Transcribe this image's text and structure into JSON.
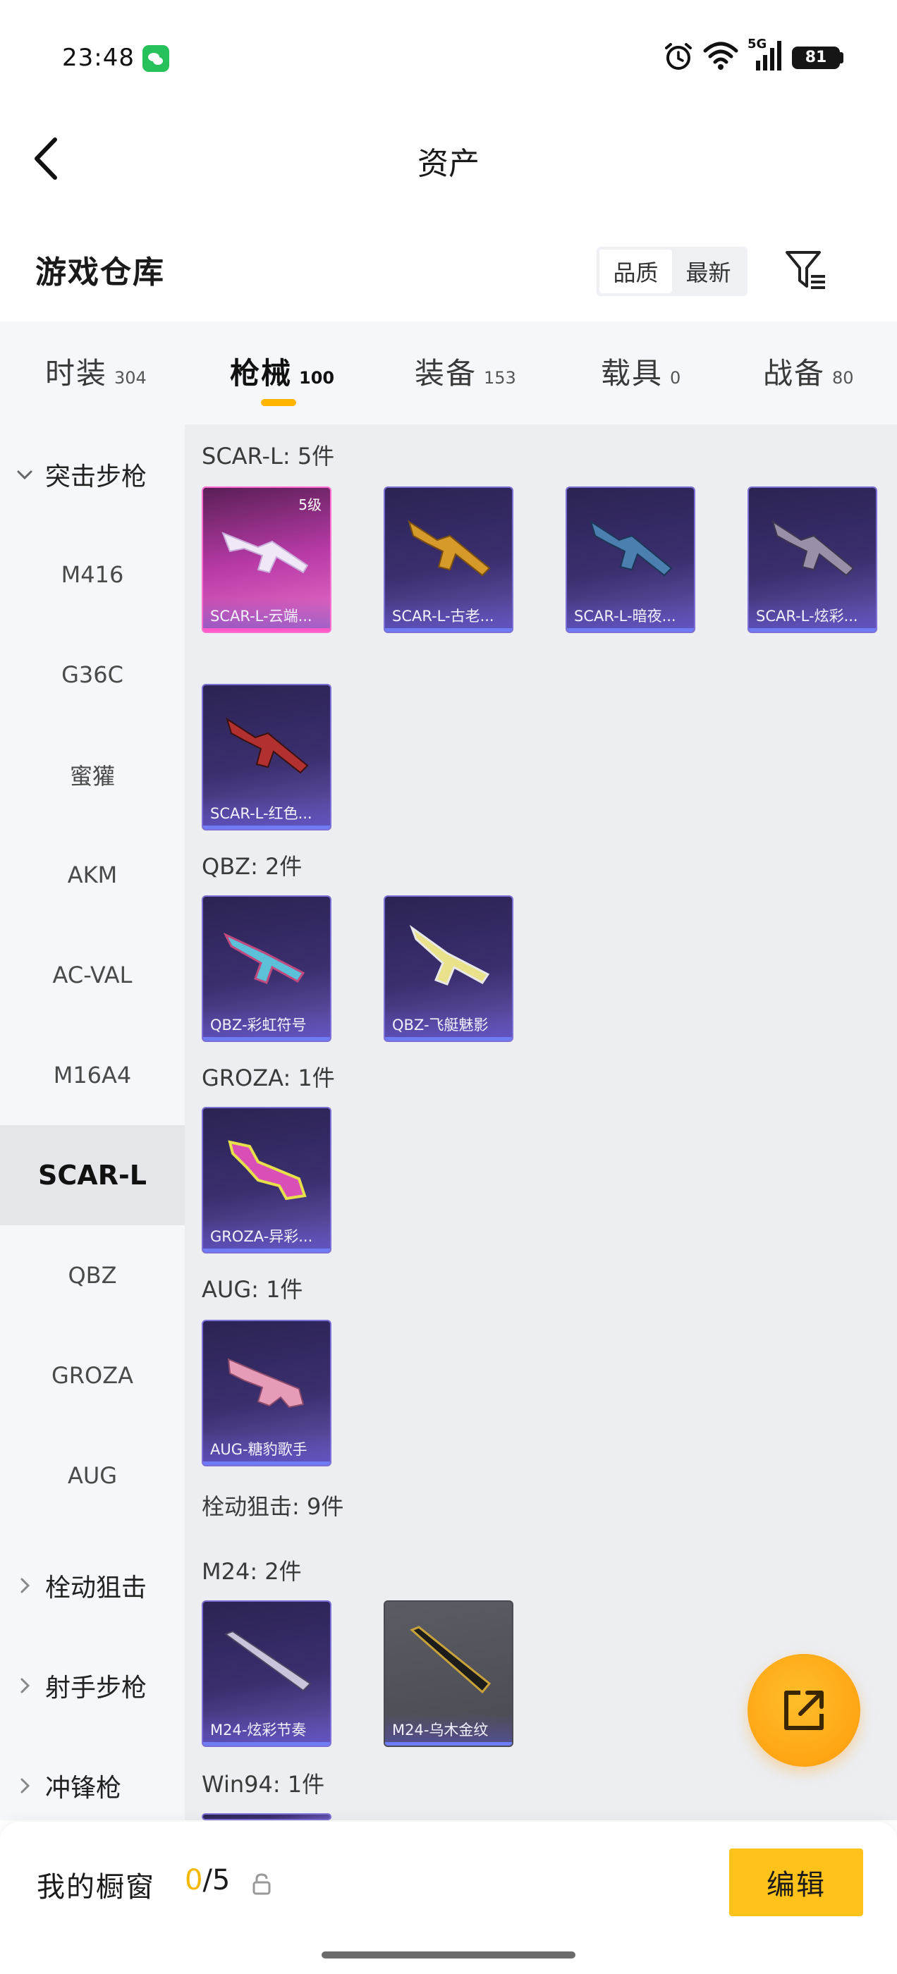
{
  "status_bar": {
    "time": "23:48",
    "network": "5G",
    "battery": "81"
  },
  "header": {
    "title": "资产"
  },
  "warehouse": {
    "title": "游戏仓库",
    "sort_options": [
      "品质",
      "最新"
    ],
    "active_sort_index": 0
  },
  "tabs": [
    {
      "label": "时装",
      "count": "304"
    },
    {
      "label": "枪械",
      "count": "100"
    },
    {
      "label": "装备",
      "count": "153"
    },
    {
      "label": "载具",
      "count": "0"
    },
    {
      "label": "战备",
      "count": "80"
    }
  ],
  "active_tab_index": 1,
  "sidebar": {
    "group_expanded": "突击步枪",
    "items": [
      "M416",
      "G36C",
      "蜜獾",
      "AKM",
      "AC-VAL",
      "M16A4",
      "SCAR-L",
      "QBZ",
      "GROZA",
      "AUG"
    ],
    "active_item": "SCAR-L",
    "collapsed_groups": [
      "栓动狙击",
      "射手步枪",
      "冲锋枪"
    ]
  },
  "content": {
    "sections": [
      {
        "label": "SCAR-L: 5件",
        "cards": [
          {
            "name": "SCAR-L-云端...",
            "rarity": "pink",
            "level": "5级"
          },
          {
            "name": "SCAR-L-古老...",
            "rarity": "purple"
          },
          {
            "name": "SCAR-L-暗夜...",
            "rarity": "purple"
          },
          {
            "name": "SCAR-L-炫彩...",
            "rarity": "purple"
          },
          {
            "name": "SCAR-L-红色...",
            "rarity": "purple"
          }
        ]
      },
      {
        "label": "QBZ: 2件",
        "cards": [
          {
            "name": "QBZ-彩虹符号",
            "rarity": "purple"
          },
          {
            "name": "QBZ-飞艇魅影",
            "rarity": "purple"
          }
        ]
      },
      {
        "label": "GROZA: 1件",
        "cards": [
          {
            "name": "GROZA-异彩...",
            "rarity": "purple"
          }
        ]
      },
      {
        "label": "AUG: 1件",
        "cards": [
          {
            "name": "AUG-糖豹歌手",
            "rarity": "purple"
          }
        ]
      },
      {
        "label": "栓动狙击: 9件",
        "cards": []
      },
      {
        "label": "M24: 2件",
        "cards": [
          {
            "name": "M24-炫彩节奏",
            "rarity": "purple"
          },
          {
            "name": "M24-乌木金纹",
            "rarity": "gray"
          }
        ]
      },
      {
        "label": "Win94: 1件",
        "cards": []
      }
    ]
  },
  "bottom_bar": {
    "showcase_label": "我的橱窗",
    "showcase_current": "0",
    "showcase_total": "/5",
    "edit_label": "编辑"
  },
  "colors": {
    "accent": "#ffc21a",
    "tab_indicator": "#ffb400",
    "rarity_purple": "#7b6fd6",
    "rarity_pink": "#ff6fd0"
  }
}
